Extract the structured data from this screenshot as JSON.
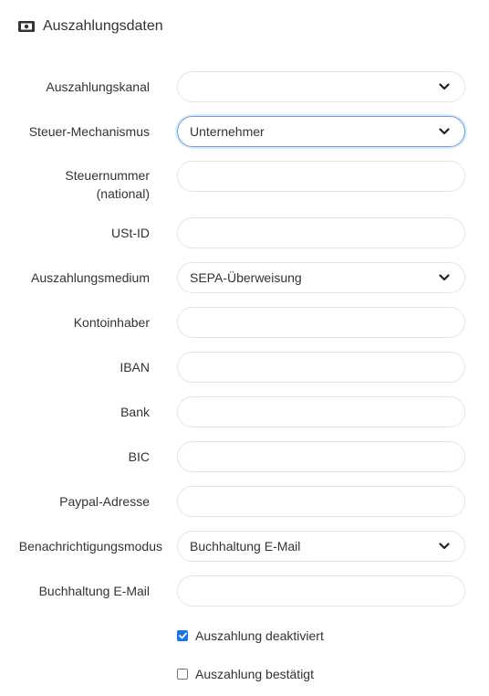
{
  "section": {
    "title": "Auszahlungsdaten",
    "icon": "money-icon"
  },
  "fields": {
    "kanal": {
      "label": "Auszahlungskanal",
      "value": ""
    },
    "steuer": {
      "label": "Steuer-Mechanismus",
      "value": "Unternehmer"
    },
    "steuernummer": {
      "label": "Steuernummer (national)",
      "value": ""
    },
    "ustid": {
      "label": "USt-ID",
      "value": ""
    },
    "medium": {
      "label": "Auszahlungsmedium",
      "value": "SEPA-Überweisung"
    },
    "kontoinhaber": {
      "label": "Kontoinhaber",
      "value": ""
    },
    "iban": {
      "label": "IBAN",
      "value": ""
    },
    "bank": {
      "label": "Bank",
      "value": ""
    },
    "bic": {
      "label": "BIC",
      "value": ""
    },
    "paypal": {
      "label": "Paypal-Adresse",
      "value": ""
    },
    "modus": {
      "label": "Benachrichtigungsmodus",
      "value": "Buchhaltung E-Mail"
    },
    "email": {
      "label": "Buchhaltung E-Mail",
      "value": ""
    }
  },
  "checkboxes": {
    "deaktiviert": {
      "label": "Auszahlung deaktiviert",
      "checked": true
    },
    "bestaetigt": {
      "label": "Auszahlung bestätigt",
      "checked": false
    }
  },
  "colors": {
    "focus": "#6b9fd6",
    "checkbox_checked": "#1a73e8",
    "border": "#e3e3e3"
  }
}
